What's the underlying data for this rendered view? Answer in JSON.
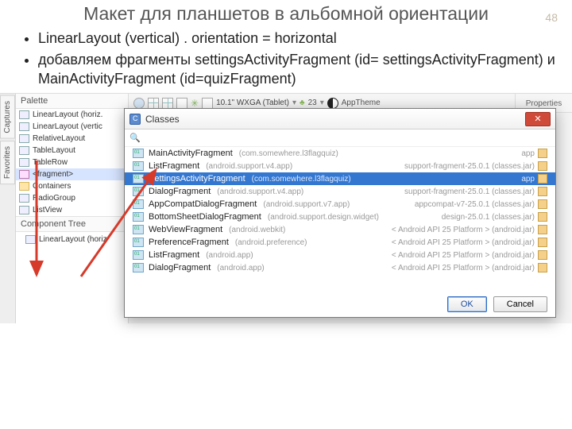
{
  "slide": {
    "title": "Макет для планшетов в альбомной ориентации",
    "page_number": "48",
    "bullets": [
      "LinearLayout (vertical) . orientation = horizontal",
      "добавляем фрагменты settingsActivityFragment (id= settingsActivityFragment) и MainActivityFragment (id=quizFragment)"
    ]
  },
  "ide": {
    "vertical_tabs": [
      "Captures",
      "Favorites"
    ],
    "palette_header": "Palette",
    "palette_items": [
      {
        "label": "LinearLayout (horiz.",
        "sel": false
      },
      {
        "label": "LinearLayout (vertic",
        "sel": false
      },
      {
        "label": "RelativeLayout",
        "sel": false
      },
      {
        "label": "TableLayout",
        "sel": false
      },
      {
        "label": "TableRow",
        "sel": false
      },
      {
        "label": "<fragment>",
        "sel": true
      },
      {
        "label": "Containers",
        "sel": false,
        "folder": true
      },
      {
        "label": "RadioGroup",
        "sel": false
      },
      {
        "label": "ListView",
        "sel": false
      }
    ],
    "component_tree_header": "Component Tree",
    "component_tree_item": "LinearLayout (horiz",
    "toolbar": {
      "device": "10.1\" WXGA (Tablet)",
      "api": "23",
      "theme": "AppTheme"
    },
    "properties_header": "Properties"
  },
  "dialog": {
    "title": "Classes",
    "rows": [
      {
        "name": "MainActivityFragment",
        "pkg": "(com.somewhere.l3flagquiz)",
        "meta": "app",
        "sel": false
      },
      {
        "name": "ListFragment",
        "pkg": "(android.support.v4.app)",
        "meta": "support-fragment-25.0.1 (classes.jar)",
        "sel": false
      },
      {
        "name": "SettingsActivityFragment",
        "pkg": "(com.somewhere.l3flagquiz)",
        "meta": "app",
        "sel": true
      },
      {
        "name": "DialogFragment",
        "pkg": "(android.support.v4.app)",
        "meta": "support-fragment-25.0.1 (classes.jar)",
        "sel": false
      },
      {
        "name": "AppCompatDialogFragment",
        "pkg": "(android.support.v7.app)",
        "meta": "appcompat-v7-25.0.1 (classes.jar)",
        "sel": false
      },
      {
        "name": "BottomSheetDialogFragment",
        "pkg": "(android.support.design.widget)",
        "meta": "design-25.0.1 (classes.jar)",
        "sel": false
      },
      {
        "name": "WebViewFragment",
        "pkg": "(android.webkit)",
        "meta": "< Android API 25 Platform > (android.jar)",
        "sel": false
      },
      {
        "name": "PreferenceFragment",
        "pkg": "(android.preference)",
        "meta": "< Android API 25 Platform > (android.jar)",
        "sel": false
      },
      {
        "name": "ListFragment",
        "pkg": "(android.app)",
        "meta": "< Android API 25 Platform > (android.jar)",
        "sel": false
      },
      {
        "name": "DialogFragment",
        "pkg": "(android.app)",
        "meta": "< Android API 25 Platform > (android.jar)",
        "sel": false
      }
    ],
    "buttons": {
      "ok": "OK",
      "cancel": "Cancel"
    }
  }
}
